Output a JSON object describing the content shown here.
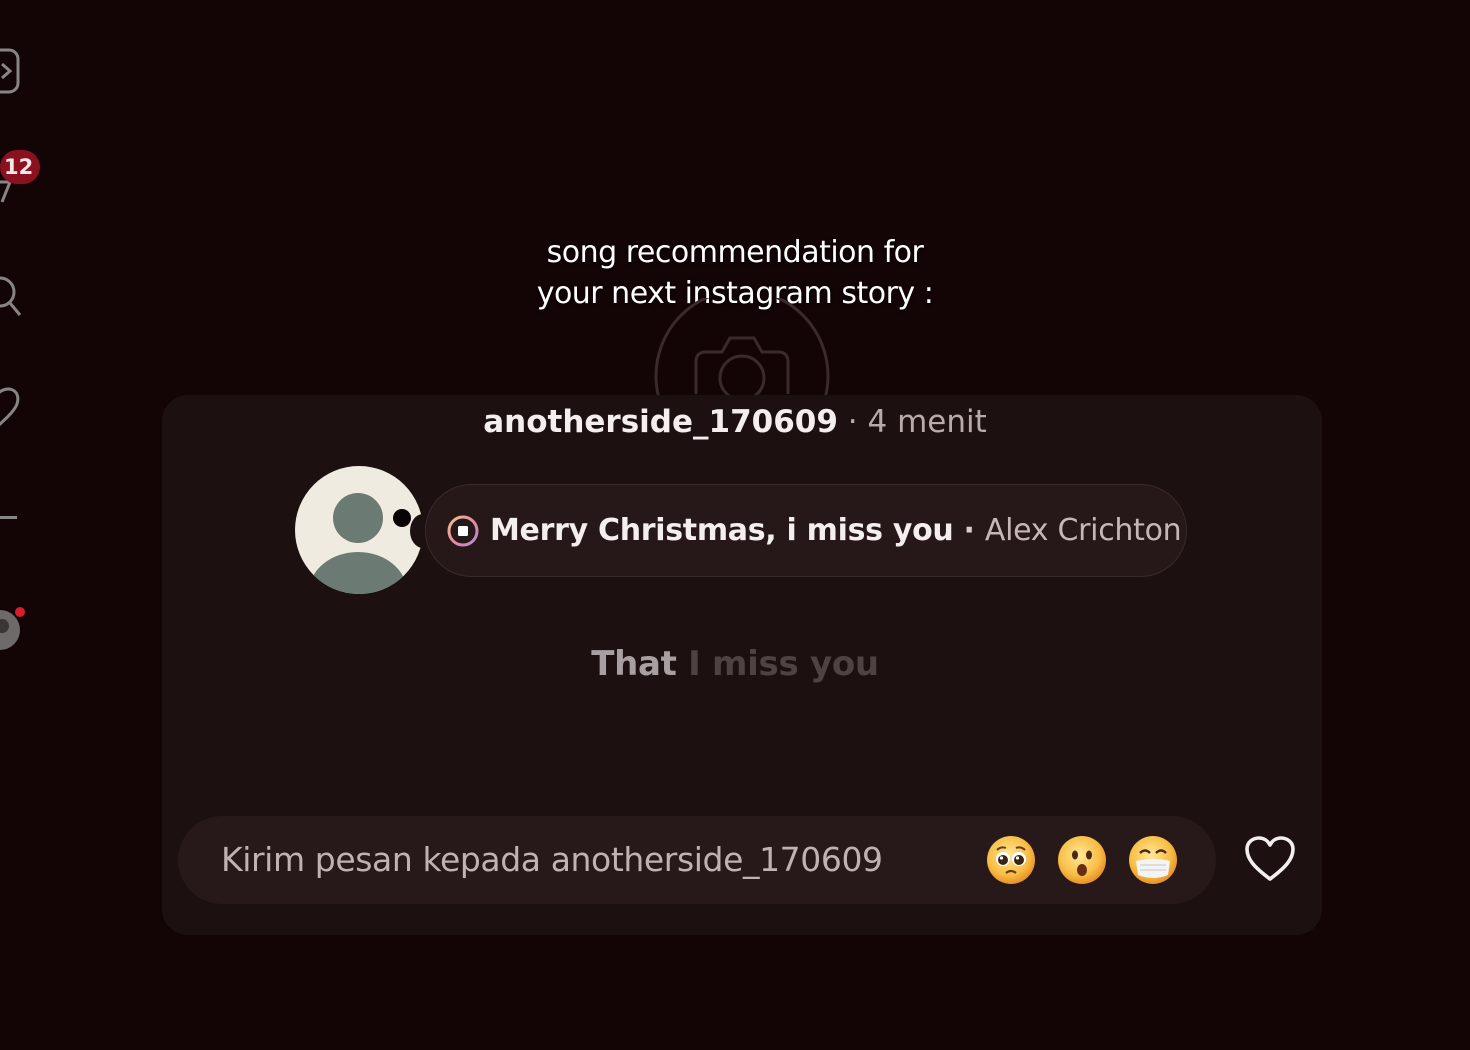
{
  "sidebar": {
    "notifications_badge": "12",
    "icons": [
      "reels-icon",
      "messages-icon",
      "search-icon",
      "heart-icon",
      "menu-icon",
      "profile-avatar"
    ]
  },
  "caption": {
    "line1": "song recommendation for",
    "line2": "your next instagram story :"
  },
  "story": {
    "username": "anotherside_170609",
    "separator": "·",
    "time": "4 menit",
    "music": {
      "icon": "music-note-icon",
      "song": "Merry Christmas, i miss you",
      "separator": "·",
      "artist": "Alex Crichton"
    },
    "lyrics": {
      "active": "That",
      "inactive": "I miss you"
    }
  },
  "reply_bar": {
    "placeholder": "Kirim pesan kepada anotherside_170609",
    "quick_reactions": [
      "pleading-face",
      "astonished-face",
      "face-with-medical-mask"
    ],
    "like_icon": "heart-icon"
  },
  "colors": {
    "background": "#130406",
    "panel": "#1d1011",
    "pill": "#261718",
    "badge": "#8a1220"
  }
}
